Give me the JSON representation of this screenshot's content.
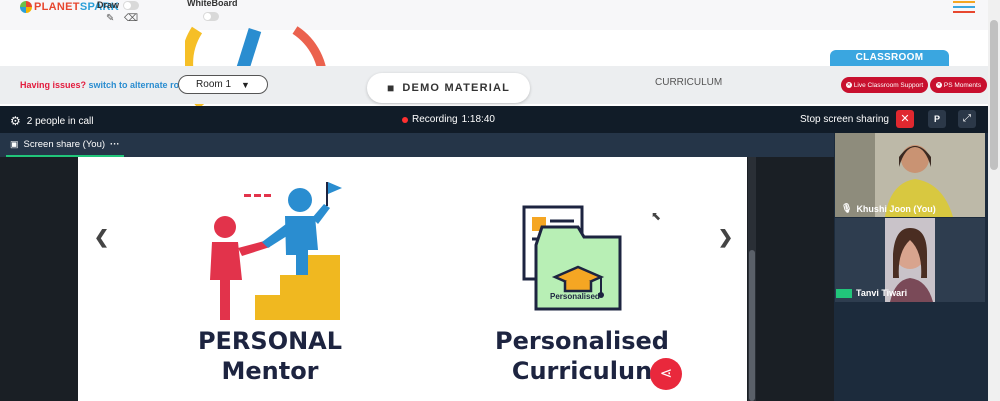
{
  "brand": {
    "logo_text_1": "PLANET",
    "logo_text_2": "SPARK"
  },
  "tools": {
    "draw_label": "Draw",
    "whiteboard_label": "WhiteBoard"
  },
  "toolbar": {
    "issues_question": "Having issues?",
    "issues_link": "switch to alternate room",
    "room_value": "Room 1",
    "demo_material_label": "DEMO MATERIAL",
    "curriculum_label": "CURRICULUM",
    "classroom_tab_label": "CLASSROOM",
    "live_support_label": "Live Classroom Support",
    "ps_moments_label": "PS Moments"
  },
  "call": {
    "people_count": "2 people in call",
    "recording_label": "Recording",
    "recording_time": "1:18:40",
    "stop_sharing_label": "Stop screen sharing",
    "p_button_label": "P",
    "screen_share_tab": "Screen share (You)",
    "tab_more": "···"
  },
  "slide": {
    "left_title_line1": "PERSONAL",
    "left_title_line2": "Mentor",
    "right_title_line1": "Personalised",
    "right_title_line2": "Curriculun",
    "folder_label": "Personalised"
  },
  "participants": [
    {
      "name": "Khushi Joon (You)"
    },
    {
      "name": "Tanvi Tiwari"
    }
  ],
  "colors": {
    "accent_red": "#c8102e",
    "brand_blue": "#3aa6e0",
    "call_bg": "#1c2b3c"
  }
}
